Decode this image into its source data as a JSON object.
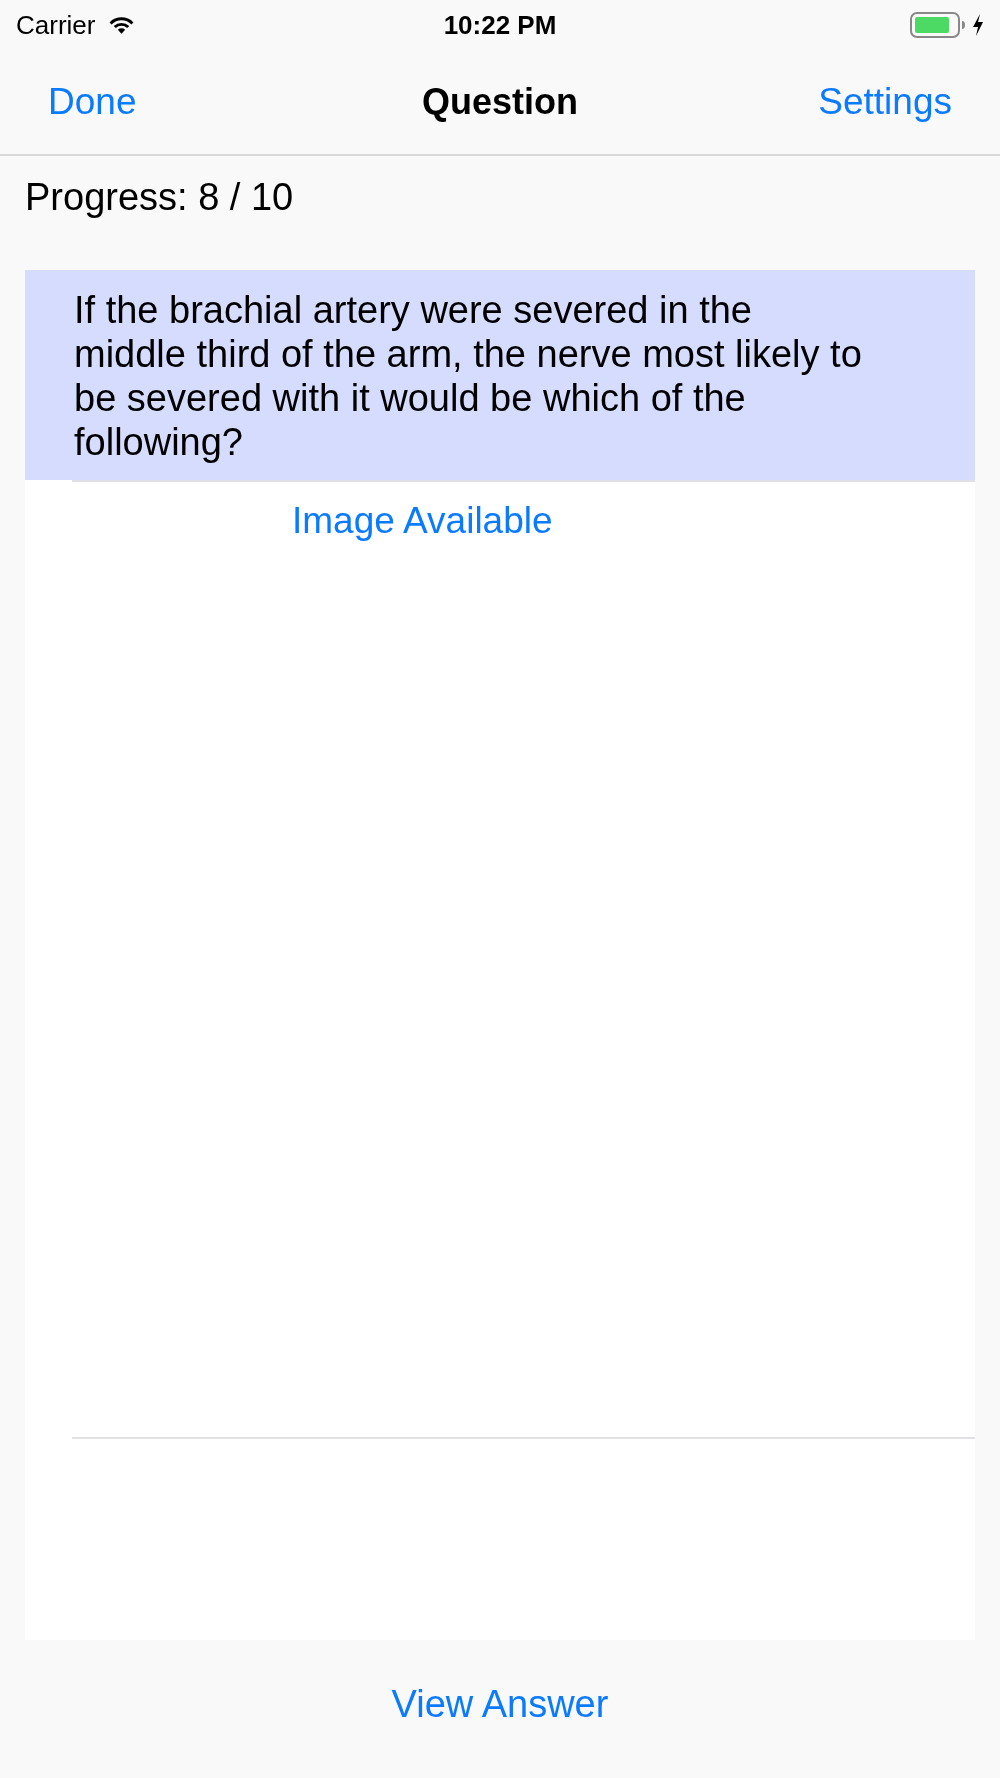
{
  "status_bar": {
    "carrier": "Carrier",
    "time": "10:22 PM"
  },
  "nav_bar": {
    "left_button": "Done",
    "title": "Question",
    "right_button": "Settings"
  },
  "progress": "Progress: 8 / 10",
  "question": "If the brachial artery were severed in the middle third of the arm, the nerve most likely to be severed with it would be which of the following?",
  "image_link": "Image Available",
  "footer_button": "View Answer"
}
